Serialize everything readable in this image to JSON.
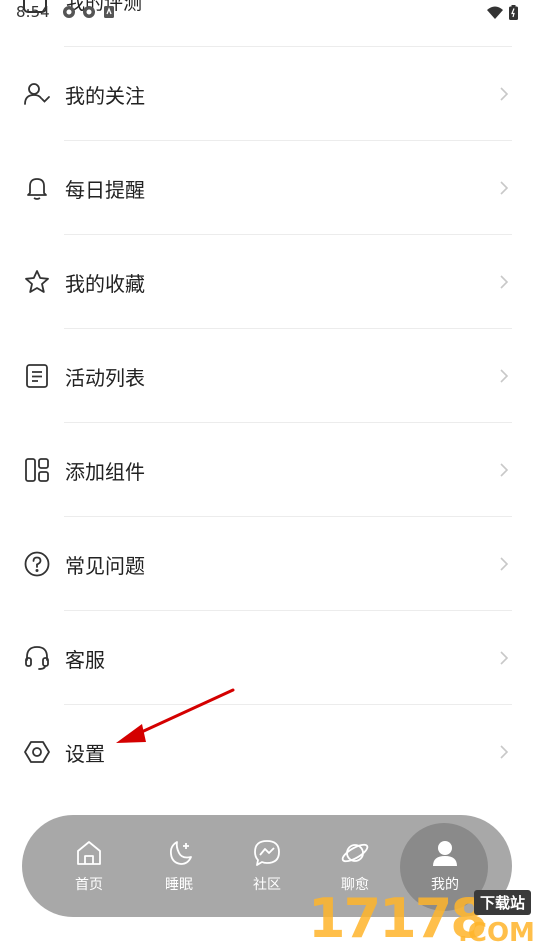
{
  "status_bar": {
    "time": "8:54"
  },
  "top_partial_item": {
    "label": "我的评测"
  },
  "menu_items": [
    {
      "label": "我的关注",
      "icon": "user-check-icon"
    },
    {
      "label": "每日提醒",
      "icon": "bell-icon"
    },
    {
      "label": "我的收藏",
      "icon": "star-icon"
    },
    {
      "label": "活动列表",
      "icon": "document-list-icon"
    },
    {
      "label": "添加组件",
      "icon": "widget-grid-icon"
    },
    {
      "label": "常见问题",
      "icon": "question-circle-icon"
    },
    {
      "label": "客服",
      "icon": "headset-icon"
    },
    {
      "label": "设置",
      "icon": "hexagon-settings-icon"
    }
  ],
  "tabbar": {
    "tabs": [
      {
        "label": "首页",
        "icon": "home-icon"
      },
      {
        "label": "睡眠",
        "icon": "moon-icon"
      },
      {
        "label": "社区",
        "icon": "messenger-icon"
      },
      {
        "label": "聊愈",
        "icon": "planet-icon"
      },
      {
        "label": "我的",
        "icon": "profile-icon",
        "active": true
      }
    ]
  },
  "watermark": {
    "digits": "17178",
    "domain": ".COM",
    "tag": "下载站"
  },
  "colors": {
    "tabbar_bg": "#a8a8a8",
    "active_bubble": "#8a8a8a",
    "annotation_arrow": "#d40000"
  }
}
